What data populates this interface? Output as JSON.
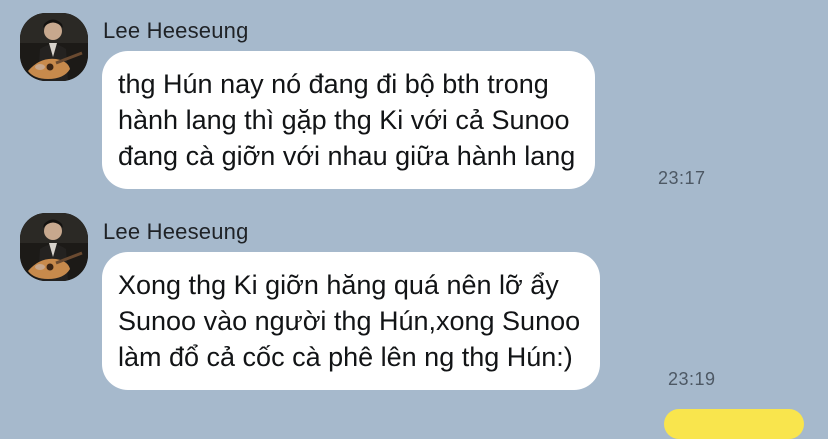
{
  "messages": [
    {
      "sender": "Lee Heeseung",
      "avatar_icon": "guitarist-avatar-photo",
      "lines": [
        "thg Hún nay nó đang đi bộ bth trong",
        "hành lang thì gặp thg Ki với cả Sunoo",
        "đang cà giỡn với nhau giữa hành lang"
      ],
      "time": "23:17"
    },
    {
      "sender": "Lee Heeseung",
      "avatar_icon": "guitarist-avatar-photo",
      "lines": [
        "Xong thg Ki giỡn hăng quá nên lỡ ẩy",
        "Sunoo vào người thg Hún,xong Sunoo",
        "làm đổ cả cốc cà phê lên ng thg Hún:)"
      ],
      "time": "23:19"
    }
  ],
  "colors": {
    "chat_background": "#a6b9cc",
    "incoming_bubble": "#ffffff",
    "outgoing_bubble": "#f9e54d"
  }
}
